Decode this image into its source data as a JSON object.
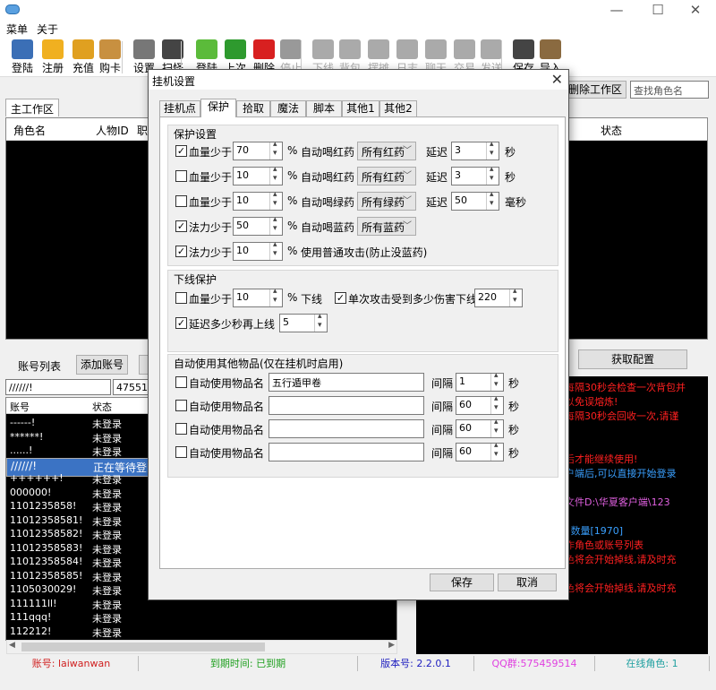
{
  "app": {
    "menu": [
      "菜单",
      "关于"
    ]
  },
  "toolbar": [
    {
      "label": "登陆",
      "icon": "users-icon"
    },
    {
      "label": "注册",
      "icon": "add-user-icon"
    },
    {
      "label": "充值",
      "icon": "umbrella-icon"
    },
    {
      "label": "购卡",
      "icon": "card-icon"
    },
    {
      "label": "设置",
      "icon": "gear-icon"
    },
    {
      "label": "扫怪",
      "icon": "save-icon"
    },
    {
      "label": "登陆",
      "icon": "green-dots-icon"
    },
    {
      "label": "上次",
      "icon": "refresh-icon"
    },
    {
      "label": "删除",
      "icon": "delete-icon"
    },
    {
      "label": "停止",
      "icon": "stop-icon"
    },
    {
      "label": "下线",
      "icon": "logout-icon"
    },
    {
      "label": "背包",
      "icon": "bag-icon"
    },
    {
      "label": "摆摊",
      "icon": "stall-icon"
    },
    {
      "label": "日志",
      "icon": "log-icon"
    },
    {
      "label": "聊天",
      "icon": "chat-icon"
    },
    {
      "label": "交易",
      "icon": "scale-icon"
    },
    {
      "label": "发送",
      "icon": "send-icon"
    },
    {
      "label": "保存",
      "icon": "disk-icon"
    },
    {
      "label": "导入",
      "icon": "import-icon"
    }
  ],
  "main": {
    "delete_workarea": "删除工作区",
    "search_placeholder": "查找角色名",
    "work_tab": "主工作区",
    "columns": [
      "角色名",
      "人物ID",
      "职",
      "状态"
    ],
    "account_list_label": "账号列表",
    "add_account": "添加账号",
    "get_config": "获取配置",
    "filter_value": "//////!",
    "id_value": "4755167",
    "acc_headers": [
      "账号",
      "状态"
    ],
    "accounts": [
      {
        "name": "------!",
        "status": "未登录"
      },
      {
        "name": "******!",
        "status": "未登录"
      },
      {
        "name": "......!",
        "status": "未登录"
      },
      {
        "name": "//////!",
        "status": "正在等待登陆",
        "selected": true
      },
      {
        "name": "++++++!",
        "status": "未登录"
      },
      {
        "name": "000000!",
        "status": "未登录"
      },
      {
        "name": "1101235858!",
        "status": "未登录"
      },
      {
        "name": "11012358581!",
        "status": "未登录"
      },
      {
        "name": "11012358582!",
        "status": "未登录"
      },
      {
        "name": "11012358583!",
        "status": "未登录"
      },
      {
        "name": "11012358584!",
        "status": "未登录"
      },
      {
        "name": "11012358585!",
        "status": "未登录"
      },
      {
        "name": "1105030029!",
        "status": "未登录"
      },
      {
        "name": "111111ll!",
        "status": "未登录"
      },
      {
        "name": "111qqq!",
        "status": "未登录"
      },
      {
        "name": "112212!",
        "status": "未登录"
      }
    ],
    "log": [
      {
        "text": "每隔30秒会检查一次背包并",
        "color": "#ff2020"
      },
      {
        "text": "以免误熔炼!",
        "color": "#ff2020"
      },
      {
        "text": "每隔30秒会回收一次,请谨",
        "color": "#ff2020"
      },
      {
        "text": "",
        "color": "#ff2020"
      },
      {
        "text": "",
        "color": "#ff2020"
      },
      {
        "text": "后才能继续使用!",
        "color": "#ff2020"
      },
      {
        "text": "户端后,可以直接开始登录",
        "color": "#3aa0ff"
      },
      {
        "text": "",
        "color": "#3aa0ff"
      },
      {
        "text": "文件D:\\华夏客户端\\123",
        "color": "#e060e0"
      },
      {
        "text": "",
        "color": "#e060e0"
      },
      {
        "text": "长 数量[1970]",
        "color": "#3aa0ff"
      },
      {
        "text": "作角色或账号列表",
        "color": "#ff2020"
      },
      {
        "text": "色将会开始掉线,请及时充",
        "color": "#ff2020"
      },
      {
        "text": "",
        "color": "#ff2020"
      },
      {
        "text": "色将会开始掉线,请及时充",
        "color": "#ff2020"
      }
    ],
    "status": [
      {
        "text": "账号: laiwanwan",
        "color": "#d02020"
      },
      {
        "text": "到期时间: 已到期",
        "color": "#20a020"
      },
      {
        "text": "版本号: 2.2.0.1",
        "color": "#2020c0"
      },
      {
        "text": "QQ群:575459514",
        "color": "#e040e0"
      },
      {
        "text": "在线角色: 1",
        "color": "#20a0a0"
      }
    ]
  },
  "dialog": {
    "title": "挂机设置",
    "tabs": [
      "挂机点",
      "保护",
      "拾取",
      "魔法",
      "脚本",
      "其他1",
      "其他2"
    ],
    "active_tab": 1,
    "protect": {
      "title": "保护设置",
      "rows": [
        {
          "checked": true,
          "label": "血量少于",
          "value": "70",
          "auto": "自动喝红药",
          "select": "所有红药",
          "delay_label": "延迟",
          "delay": "3",
          "unit": "秒"
        },
        {
          "checked": false,
          "label": "血量少于",
          "value": "10",
          "auto": "自动喝红药",
          "select": "所有红药",
          "delay_label": "延迟",
          "delay": "3",
          "unit": "秒"
        },
        {
          "checked": false,
          "label": "血量少于",
          "value": "10",
          "auto": "自动喝绿药",
          "select": "所有绿药",
          "delay_label": "延迟",
          "delay": "50",
          "unit": "毫秒"
        },
        {
          "checked": true,
          "label": "法力少于",
          "value": "50",
          "auto": "自动喝蓝药",
          "select": "所有蓝药"
        },
        {
          "checked": true,
          "label": "法力少于",
          "value": "10",
          "auto": "使用普通攻击(防止没蓝药)"
        }
      ],
      "percent": "%"
    },
    "offline": {
      "title": "下线保护",
      "hp_checked": false,
      "hp_label": "血量少于",
      "hp_value": "10",
      "hp_suffix": "下线",
      "single_checked": true,
      "single_label": "单次攻击受到多少伤害下线",
      "single_value": "220",
      "delay_checked": true,
      "delay_label": "延迟多少秒再上线",
      "delay_value": "5",
      "percent": "%"
    },
    "items": {
      "title": "自动使用其他物品(仅在挂机时启用)",
      "rows": [
        {
          "checked": false,
          "label": "自动使用物品名",
          "value": "五行遁甲卷",
          "interval_label": "间隔",
          "interval": "1",
          "unit": "秒"
        },
        {
          "checked": false,
          "label": "自动使用物品名",
          "value": "",
          "interval_label": "间隔",
          "interval": "60",
          "unit": "秒"
        },
        {
          "checked": false,
          "label": "自动使用物品名",
          "value": "",
          "interval_label": "间隔",
          "interval": "60",
          "unit": "秒"
        },
        {
          "checked": false,
          "label": "自动使用物品名",
          "value": "",
          "interval_label": "间隔",
          "interval": "60",
          "unit": "秒"
        }
      ]
    },
    "save": "保存",
    "cancel": "取消"
  }
}
